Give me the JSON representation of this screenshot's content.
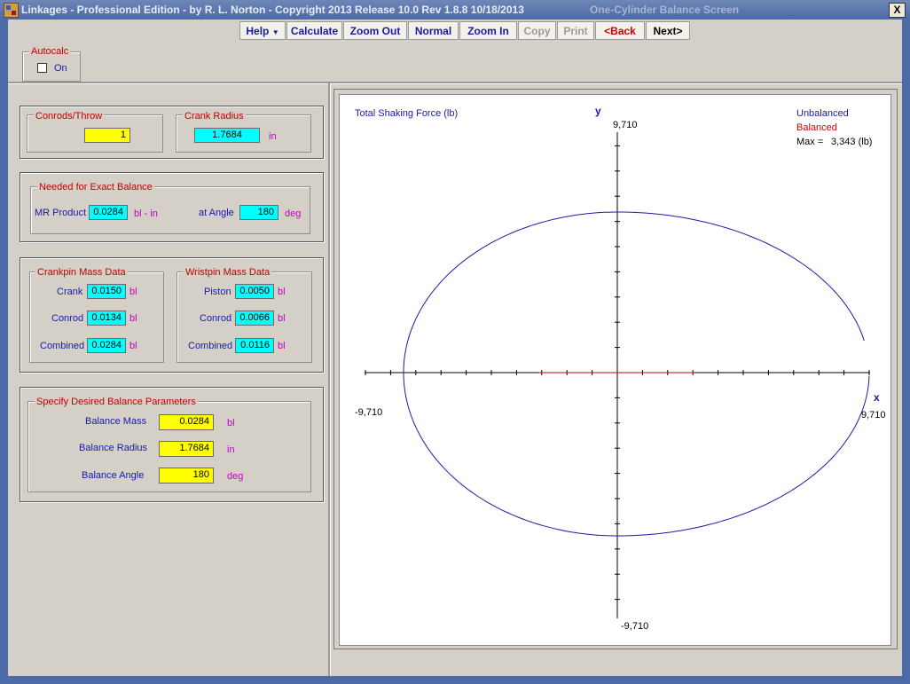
{
  "window": {
    "title": "Linkages - Professional Edition - by R. L. Norton - Copyright 2013   Release 10.0   Rev 1.8.8   10/18/2013",
    "screen_name": "One-Cylinder Balance Screen",
    "close_label": "X"
  },
  "toolbar": {
    "help": "Help",
    "calculate": "Calculate",
    "zoom_out": "Zoom Out",
    "normal": "Normal",
    "zoom_in": "Zoom In",
    "copy": "Copy",
    "print": "Print",
    "back": "<Back",
    "next": "Next>"
  },
  "autocalc": {
    "legend": "Autocalc",
    "checkbox_label": "On",
    "checked": false
  },
  "conrods": {
    "legend": "Conrods/Throw",
    "value": "1"
  },
  "crank_radius": {
    "legend": "Crank Radius",
    "value": "1.7684",
    "unit": "in"
  },
  "exact_balance": {
    "legend": "Needed for Exact Balance",
    "mr_label": "MR Product",
    "mr_value": "0.0284",
    "mr_unit": "bl - in",
    "angle_label": "at Angle",
    "angle_value": "180",
    "angle_unit": "deg"
  },
  "crankpin": {
    "legend": "Crankpin Mass Data",
    "rows": [
      {
        "label": "Crank",
        "value": "0.0150",
        "unit": "bl"
      },
      {
        "label": "Conrod",
        "value": "0.0134",
        "unit": "bl"
      },
      {
        "label": "Combined",
        "value": "0.0284",
        "unit": "bl"
      }
    ]
  },
  "wristpin": {
    "legend": "Wristpin Mass Data",
    "rows": [
      {
        "label": "Piston",
        "value": "0.0050",
        "unit": "bl"
      },
      {
        "label": "Conrod",
        "value": "0.0066",
        "unit": "bl"
      },
      {
        "label": "Combined",
        "value": "0.0116",
        "unit": "bl"
      }
    ]
  },
  "desired": {
    "legend": "Specify Desired Balance Parameters",
    "rows": [
      {
        "label": "Balance Mass",
        "value": "0.0284",
        "unit": "bl"
      },
      {
        "label": "Balance Radius",
        "value": "1.7684",
        "unit": "in"
      },
      {
        "label": "Balance Angle",
        "value": "180",
        "unit": "deg"
      }
    ]
  },
  "plot": {
    "title": "Total Shaking Force  (lb)",
    "x_axis_label": "x",
    "y_axis_label": "y",
    "x_min_label": "-9,710",
    "x_max_label": "9,710",
    "y_min_label": "-9,710",
    "y_max_label": "9,710",
    "legend_unbalanced": "Unbalanced",
    "legend_balanced": "Balanced",
    "max_label": "Max =",
    "max_value": "3,343 (lb)",
    "colors": {
      "unbalanced": "#1a1aa6",
      "balanced": "#d00000"
    }
  }
}
